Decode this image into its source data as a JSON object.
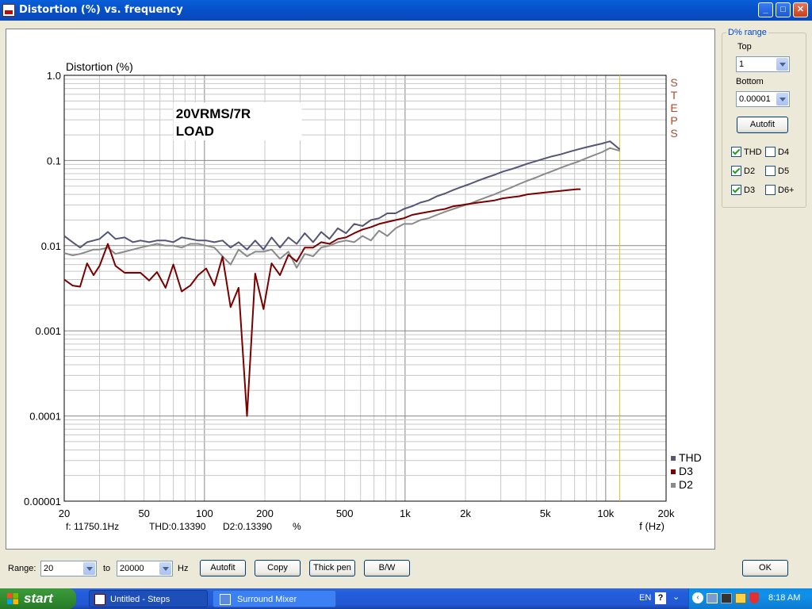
{
  "window": {
    "title": "Distortion (%) vs. frequency"
  },
  "titlebar_buttons": {
    "minimize": "_",
    "maximize": "□",
    "close": "✕"
  },
  "chart_data": {
    "type": "line",
    "ylabel": "Distortion (%)",
    "xlabel": "f (Hz)",
    "x_scale": "log",
    "y_scale": "log",
    "xlim": [
      20,
      20000
    ],
    "ylim": [
      1e-05,
      1.0
    ],
    "x_ticks": [
      20,
      50,
      100,
      200,
      500,
      1000,
      2000,
      5000,
      10000,
      20000
    ],
    "x_tick_labels": [
      "20",
      "50",
      "100",
      "200",
      "500",
      "1k",
      "2k",
      "5k",
      "10k",
      "20k"
    ],
    "y_ticks": [
      1e-05,
      0.0001,
      0.001,
      0.01,
      0.1,
      1.0
    ],
    "y_tick_labels": [
      "0.00001",
      "0.0001",
      "0.001",
      "0.01",
      "0.1",
      "1.0"
    ],
    "grid": true,
    "annotation": [
      "20VRMS/7R",
      "LOAD"
    ],
    "brand_text": [
      "S",
      "T",
      "E",
      "P",
      "S"
    ],
    "cursor_x": 11750.1,
    "legend_position": "bottom-right",
    "series": [
      {
        "name": "THD",
        "color": "#555577",
        "x": [
          20,
          22,
          24,
          26,
          28,
          30,
          33,
          36,
          40,
          44,
          48,
          53,
          58,
          64,
          70,
          77,
          85,
          93,
          102,
          112,
          123,
          135,
          148,
          163,
          179,
          197,
          216,
          238,
          262,
          288,
          316,
          348,
          382,
          420,
          462,
          508,
          558,
          614,
          675,
          742,
          816,
          897,
          986,
          1084,
          1192,
          1310,
          1440,
          1583,
          1740,
          1913,
          2103,
          2312,
          2541,
          2793,
          3070,
          3375,
          3710,
          4078,
          4483,
          4928,
          5417,
          5955,
          6546,
          7196,
          7910,
          8695,
          9558,
          10507,
          11750
        ],
        "y": [
          0.013,
          0.011,
          0.0095,
          0.011,
          0.0115,
          0.012,
          0.0145,
          0.012,
          0.0125,
          0.011,
          0.0115,
          0.011,
          0.0115,
          0.0115,
          0.011,
          0.0125,
          0.012,
          0.0115,
          0.0115,
          0.011,
          0.0115,
          0.0095,
          0.011,
          0.009,
          0.0115,
          0.009,
          0.0125,
          0.0095,
          0.0125,
          0.0105,
          0.014,
          0.011,
          0.0145,
          0.012,
          0.016,
          0.014,
          0.018,
          0.017,
          0.02,
          0.021,
          0.024,
          0.024,
          0.027,
          0.029,
          0.032,
          0.034,
          0.038,
          0.041,
          0.045,
          0.049,
          0.053,
          0.058,
          0.063,
          0.068,
          0.074,
          0.079,
          0.085,
          0.092,
          0.098,
          0.105,
          0.112,
          0.118,
          0.126,
          0.134,
          0.142,
          0.15,
          0.158,
          0.168,
          0.135
        ]
      },
      {
        "name": "D3",
        "color": "#7a0000",
        "x": [
          20,
          22,
          24,
          26,
          28,
          30,
          33,
          36,
          40,
          44,
          48,
          53,
          58,
          64,
          70,
          77,
          85,
          93,
          102,
          112,
          123,
          135,
          148,
          163,
          179,
          197,
          216,
          238,
          262,
          288,
          316,
          348,
          382,
          420,
          462,
          508,
          558,
          614,
          675,
          742,
          816,
          897,
          986,
          1084,
          1192,
          1310,
          1440,
          1583,
          1740,
          1913,
          2103,
          2312,
          2541,
          2793,
          3070,
          3375,
          3710,
          4078,
          4483,
          4928,
          5417,
          5955,
          6546,
          7196,
          7500
        ],
        "y": [
          0.004,
          0.0034,
          0.0033,
          0.0062,
          0.0045,
          0.0058,
          0.0105,
          0.0058,
          0.0048,
          0.0048,
          0.0048,
          0.0039,
          0.0049,
          0.0032,
          0.006,
          0.0029,
          0.0034,
          0.0045,
          0.0054,
          0.0034,
          0.0074,
          0.0019,
          0.0032,
          0.0001,
          0.0047,
          0.0018,
          0.0062,
          0.0045,
          0.0078,
          0.0065,
          0.0095,
          0.0095,
          0.011,
          0.0105,
          0.012,
          0.0125,
          0.014,
          0.0155,
          0.0165,
          0.018,
          0.019,
          0.02,
          0.021,
          0.023,
          0.024,
          0.025,
          0.026,
          0.027,
          0.029,
          0.03,
          0.031,
          0.032,
          0.033,
          0.034,
          0.036,
          0.037,
          0.038,
          0.04,
          0.041,
          0.042,
          0.043,
          0.044,
          0.045,
          0.046,
          0.046
        ]
      },
      {
        "name": "D2",
        "color": "#8a8a8a",
        "x": [
          20,
          22,
          24,
          26,
          28,
          30,
          33,
          36,
          40,
          44,
          48,
          53,
          58,
          64,
          70,
          77,
          85,
          93,
          102,
          112,
          123,
          135,
          148,
          163,
          179,
          197,
          216,
          238,
          262,
          288,
          316,
          348,
          382,
          420,
          462,
          508,
          558,
          614,
          675,
          742,
          816,
          897,
          986,
          1084,
          1192,
          1310,
          1440,
          1583,
          1740,
          1913,
          2103,
          2312,
          2541,
          2793,
          3070,
          3375,
          3710,
          4078,
          4483,
          4928,
          5417,
          5955,
          6546,
          7196,
          7910,
          8695,
          9558,
          10507,
          11750
        ],
        "y": [
          0.0082,
          0.0077,
          0.008,
          0.0085,
          0.009,
          0.009,
          0.0095,
          0.008,
          0.0085,
          0.009,
          0.0095,
          0.01,
          0.0105,
          0.01,
          0.01,
          0.0095,
          0.0105,
          0.0105,
          0.01,
          0.0095,
          0.0075,
          0.006,
          0.009,
          0.0075,
          0.0085,
          0.0085,
          0.009,
          0.007,
          0.0085,
          0.0055,
          0.008,
          0.0075,
          0.0095,
          0.01,
          0.011,
          0.0115,
          0.011,
          0.013,
          0.0115,
          0.015,
          0.013,
          0.016,
          0.018,
          0.018,
          0.02,
          0.021,
          0.023,
          0.025,
          0.027,
          0.029,
          0.031,
          0.034,
          0.037,
          0.04,
          0.044,
          0.048,
          0.053,
          0.058,
          0.063,
          0.069,
          0.075,
          0.082,
          0.089,
          0.096,
          0.105,
          0.115,
          0.125,
          0.14,
          0.13
        ]
      }
    ]
  },
  "readout": {
    "freq": "f:  11750.1Hz",
    "thd": "THD:0.13390",
    "d2": "D2:0.13390",
    "unit": "%"
  },
  "right_panel": {
    "group_title": "D% range",
    "top_label": "Top",
    "top_value": "1",
    "bottom_label": "Bottom",
    "bottom_value": "0.00001",
    "autofit_label": "Autofit",
    "checkboxes": [
      {
        "label": "THD",
        "checked": true
      },
      {
        "label": "D4",
        "checked": false
      },
      {
        "label": "D2",
        "checked": true
      },
      {
        "label": "D5",
        "checked": false
      },
      {
        "label": "D3",
        "checked": true
      },
      {
        "label": "D6+",
        "checked": false
      }
    ]
  },
  "bottom_bar": {
    "range_label": "Range:",
    "range_from": "20",
    "to_label": "to",
    "range_to": "20000",
    "unit_label": "Hz",
    "autofit_label": "Autofit",
    "copy_label": "Copy",
    "thickpen_label": "Thick pen",
    "bw_label": "B/W",
    "ok_label": "OK"
  },
  "taskbar": {
    "start_label": "start",
    "tasks": [
      {
        "label": "Untitled - Steps"
      },
      {
        "label": "Surround Mixer"
      }
    ],
    "lang": "EN",
    "clock": "8:18 AM"
  }
}
